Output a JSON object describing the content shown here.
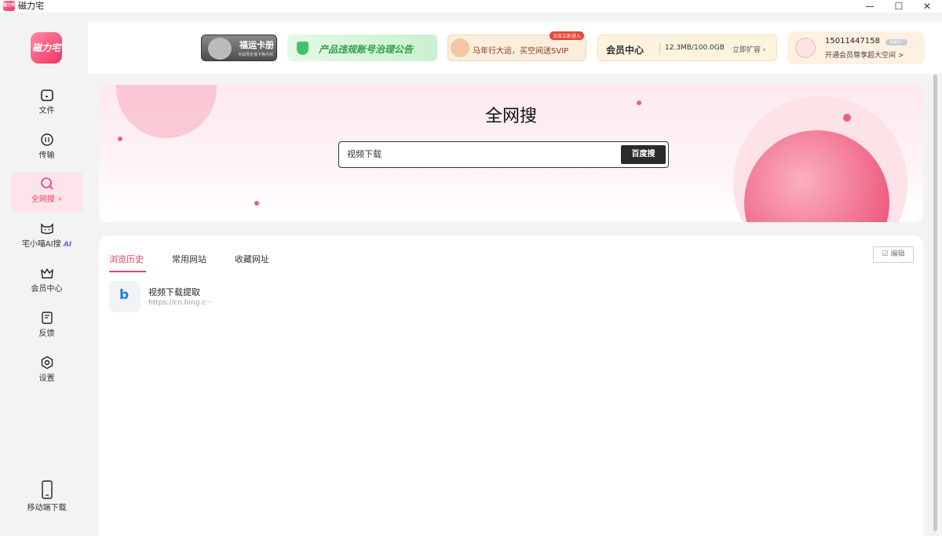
{
  "window": {
    "title": "磁力宅",
    "icon_text": "磁力宅",
    "controls": {
      "minimize": "—",
      "maximize": "☐",
      "close": "✕"
    }
  },
  "sidebar": {
    "logo_text": "磁力宅",
    "items": [
      {
        "label": "文件",
        "icon": "folder-icon"
      },
      {
        "label": "传输",
        "icon": "transfer-icon"
      },
      {
        "label": "全网搜",
        "icon": "search-icon",
        "active": true,
        "badge": "⚡"
      },
      {
        "label": "宅小喵AI搜",
        "icon": "cat-icon",
        "badge": "AI"
      },
      {
        "label": "会员中心",
        "icon": "crown-icon"
      },
      {
        "label": "反馈",
        "icon": "feedback-icon"
      },
      {
        "label": "设置",
        "icon": "settings-icon"
      }
    ],
    "mobile_download": {
      "label": "移动端下载",
      "icon": "phone-icon"
    }
  },
  "topbar": {
    "banner_card": {
      "title": "福运卡册",
      "subtitle": "专属限定福卡等你领"
    },
    "banner_notice": {
      "title": "产品违规账号治理公告"
    },
    "banner_promo": {
      "title": "马年行大运，买空间送SVIP",
      "tag": "点击立即进入"
    },
    "member_center": {
      "title": "会员中心",
      "quota": "12.3MB/100.0GB",
      "upgrade": "立即扩容 ›"
    },
    "user": {
      "phone": "15011447158",
      "vip_badge": "普通用户",
      "subtitle": "开通会员尊享超大空间 >"
    }
  },
  "hero": {
    "title": "全网搜",
    "search_value": "视频下载",
    "search_button": "百度搜"
  },
  "content": {
    "tabs": [
      {
        "label": "浏览历史",
        "active": true
      },
      {
        "label": "常用网站",
        "active": false
      },
      {
        "label": "收藏网址",
        "active": false
      }
    ],
    "edit_button": "☑ 编辑",
    "history": [
      {
        "title": "视频下载提取",
        "url": "https://cn.bing.c···",
        "icon_letter": "b"
      }
    ]
  },
  "colors": {
    "accent": "#ee3e66",
    "active_bg": "#fde4ea"
  }
}
